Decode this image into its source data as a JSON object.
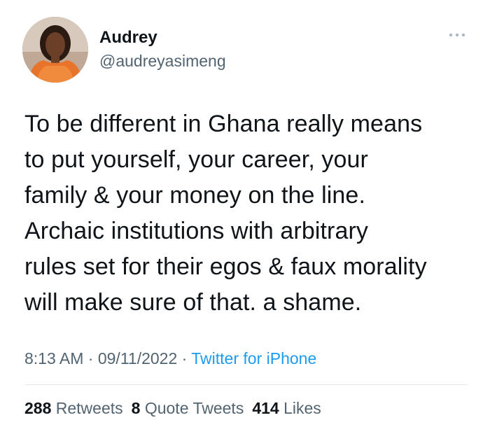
{
  "author": {
    "name": "Audrey",
    "handle": "@audreyasimeng",
    "avatar_icon": "user-avatar-photo"
  },
  "menu": {
    "icon": "more-horizontal-icon"
  },
  "tweet": {
    "text": "To be different in Ghana really means\nto put yourself, your career, your\nfamily & your money on the line.\nArchaic institutions with arbitrary\nrules set for their egos & faux morality\nwill make sure of that. a shame."
  },
  "meta": {
    "time": "8:13 AM",
    "separator": " · ",
    "date": "09/11/2022",
    "source": "Twitter for iPhone"
  },
  "stats": {
    "retweets_count": "288",
    "retweets_label": "Retweets",
    "quotes_count": "8",
    "quotes_label": "Quote Tweets",
    "likes_count": "414",
    "likes_label": "Likes"
  },
  "colors": {
    "text_primary": "#0f1419",
    "text_secondary": "#536471",
    "link": "#1d9bf0",
    "divider": "#e6e9ec"
  }
}
